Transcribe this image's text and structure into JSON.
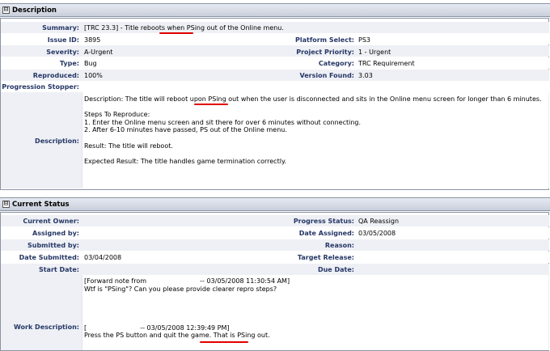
{
  "description_panel": {
    "toggle": "⊟",
    "title": "Description",
    "fields": {
      "summary": {
        "label": "Summary:",
        "value": "[TRC 23.3] - Title reboots when PSing out of the Online menu."
      },
      "issue_id": {
        "label": "Issue ID:",
        "value": "3895"
      },
      "platform_select": {
        "label": "Platform Select:",
        "value": "PS3"
      },
      "severity": {
        "label": "Severity:",
        "value": "A-Urgent"
      },
      "project_priority": {
        "label": "Project Priority:",
        "value": "1 - Urgent"
      },
      "type": {
        "label": "Type:",
        "value": "Bug"
      },
      "category": {
        "label": "Category:",
        "value": "TRC Requirement"
      },
      "reproduced": {
        "label": "Reproduced:",
        "value": "100%"
      },
      "version_found": {
        "label": "Version Found:",
        "value": "3.03"
      },
      "progression_stopper": {
        "label": "Progression Stopper:",
        "value": ""
      },
      "description": {
        "label": "Description:",
        "text": "Description: The title will reboot upon PSing out when the user is disconnected and sits in the Online menu screen for longer than 6 minutes.\n\nSteps To Reproduce:\n1. Enter the Online menu screen and sit there for over 6 minutes without connecting.\n2. After 6-10 minutes have passed, PS out of the Online menu.\n\nResult: The title will reboot.\n\nExpected Result: The title handles game termination correctly."
      }
    }
  },
  "status_panel": {
    "toggle": "⊟",
    "title": "Current Status",
    "fields": {
      "current_owner": {
        "label": "Current Owner:",
        "value": ""
      },
      "progress_status": {
        "label": "Progress Status:",
        "value": "QA Reassign"
      },
      "assigned_by": {
        "label": "Assigned by:",
        "value": ""
      },
      "date_assigned": {
        "label": "Date Assigned:",
        "value": "03/05/2008"
      },
      "submitted_by": {
        "label": "Submitted by:",
        "value": ""
      },
      "reason": {
        "label": "Reason:",
        "value": ""
      },
      "date_submitted": {
        "label": "Date Submitted:",
        "value": "03/04/2008"
      },
      "target_release": {
        "label": "Target Release:",
        "value": ""
      },
      "start_date": {
        "label": "Start Date:",
        "value": ""
      },
      "due_date": {
        "label": "Due Date:",
        "value": ""
      },
      "work_description": {
        "label": "Work Description:",
        "text": "[Forward note from                          -- 03/05/2008 11:30:54 AM]\nWtf is \"PSing\"? Can you please provide clearer repro steps?\n\n\n\n\n[                          -- 03/05/2008 12:39:49 PM]\nPress the PS button and quit the game. That is PSing out."
      }
    }
  },
  "colors": {
    "label_text": "#263766",
    "row_alt": "#eef0f5",
    "header": "#c9cfdb",
    "annotation_underline": "#e10000"
  }
}
